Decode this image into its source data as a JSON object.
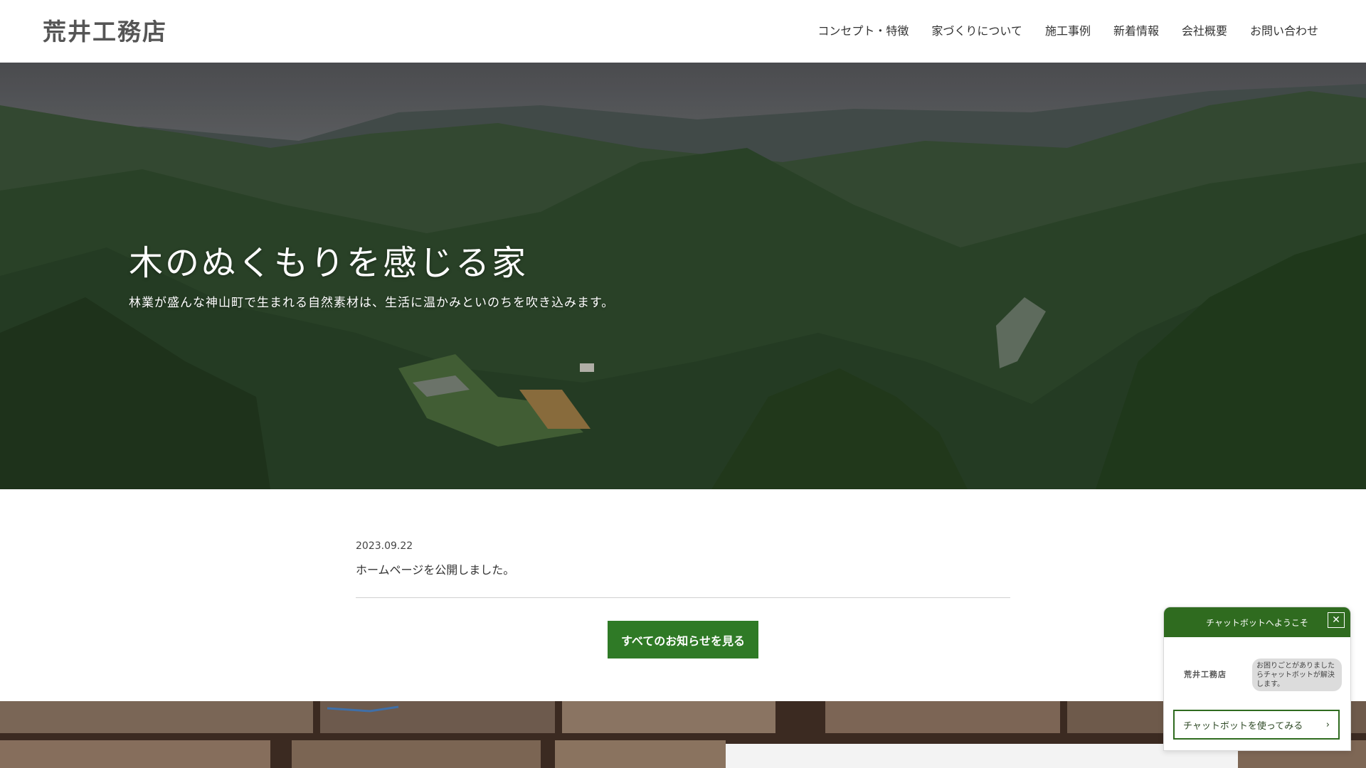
{
  "header": {
    "logo": "荒井工務店",
    "nav": [
      {
        "label": "コンセプト・特徴"
      },
      {
        "label": "家づくりについて"
      },
      {
        "label": "施工事例"
      },
      {
        "label": "新着情報"
      },
      {
        "label": "会社概要"
      },
      {
        "label": "お問い合わせ"
      }
    ]
  },
  "hero": {
    "title": "木のぬくもりを感じる家",
    "subtitle": "林業が盛んな神山町で生まれる自然素材は、生活に温かみといのちを吹き込みます。"
  },
  "news": {
    "items": [
      {
        "date": "2023.09.22",
        "text": "ホームページを公開しました。"
      }
    ],
    "button_label": "すべてのお知らせを見る"
  },
  "chatbot": {
    "title": "チャットボットへようこそ",
    "close_icon": "close-icon",
    "logo": "荒井工務店",
    "message": "お困りごとがありましたらチャットボットが解決します。",
    "button_label": "チャットボットを使ってみる",
    "button_icon": "chevron-right-icon"
  },
  "colors": {
    "accent": "#2f7a26",
    "chat_header": "#2f6b1f"
  }
}
